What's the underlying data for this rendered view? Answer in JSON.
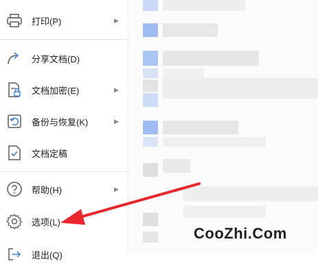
{
  "menu": {
    "items": [
      {
        "label": "打印(P)",
        "icon": "printer-icon",
        "submenu": true
      },
      {
        "label": "分享文档(D)",
        "icon": "share-icon",
        "submenu": false
      },
      {
        "label": "文档加密(E)",
        "icon": "document-lock-icon",
        "submenu": true
      },
      {
        "label": "备份与恢复(K)",
        "icon": "backup-restore-icon",
        "submenu": true
      },
      {
        "label": "文档定稿",
        "icon": "document-check-icon",
        "submenu": false
      },
      {
        "label": "帮助(H)",
        "icon": "help-icon",
        "submenu": true
      },
      {
        "label": "选项(L)",
        "icon": "gear-icon",
        "submenu": false
      },
      {
        "label": "退出(Q)",
        "icon": "exit-icon",
        "submenu": false
      }
    ],
    "submenu_arrow": "▶"
  },
  "watermark": "CooZhi.Com",
  "colors": {
    "arrow": "#e8262b",
    "icon": "#5a5a5a",
    "icon_accent": "#3a7fd8",
    "blur_blue": "#9fbdf0"
  }
}
